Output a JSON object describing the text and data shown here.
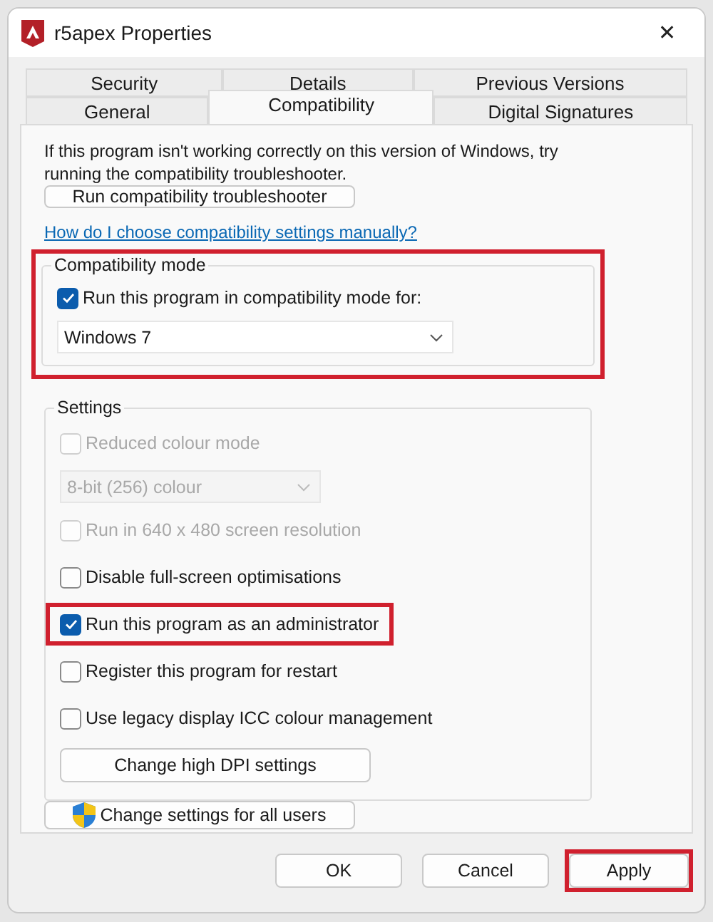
{
  "window": {
    "title": "r5apex Properties",
    "close": "✕"
  },
  "tabs": [
    [
      {
        "label": "Security",
        "selected": false
      },
      {
        "label": "Details",
        "selected": false
      },
      {
        "label": "Previous Versions",
        "selected": false
      }
    ],
    [
      {
        "label": "General",
        "selected": false
      },
      {
        "label": "Compatibility",
        "selected": true
      },
      {
        "label": "Digital Signatures",
        "selected": false
      }
    ]
  ],
  "intro": "If this program isn't working correctly on this version of Windows, try running the compatibility troubleshooter.",
  "troubleshooter_button": "Run compatibility troubleshooter",
  "help_link": "How do I choose compatibility settings manually?",
  "compatibility_mode": {
    "title": "Compatibility mode",
    "highlighted": true,
    "checkbox": {
      "label": "Run this program in compatibility mode for:",
      "checked": true
    },
    "dropdown": {
      "value": "Windows 7",
      "disabled": false
    }
  },
  "settings": {
    "title": "Settings",
    "items": [
      {
        "kind": "checkbox",
        "label": "Reduced colour mode",
        "checked": false,
        "disabled": true,
        "highlighted": false
      },
      {
        "kind": "dropdown",
        "value": "8-bit (256) colour",
        "disabled": true
      },
      {
        "kind": "checkbox",
        "label": "Run in 640 x 480 screen resolution",
        "checked": false,
        "disabled": true,
        "highlighted": false
      },
      {
        "kind": "checkbox",
        "label": "Disable full-screen optimisations",
        "checked": false,
        "disabled": false,
        "highlighted": false
      },
      {
        "kind": "checkbox",
        "label": "Run this program as an administrator",
        "checked": true,
        "disabled": false,
        "highlighted": true
      },
      {
        "kind": "checkbox",
        "label": "Register this program for restart",
        "checked": false,
        "disabled": false,
        "highlighted": false
      },
      {
        "kind": "checkbox",
        "label": "Use legacy display ICC colour management",
        "checked": false,
        "disabled": false,
        "highlighted": false
      },
      {
        "kind": "button",
        "label": "Change high DPI settings"
      }
    ]
  },
  "all_users_button": "Change settings for all users",
  "buttons": [
    {
      "label": "OK",
      "highlighted": false
    },
    {
      "label": "Cancel",
      "highlighted": false
    },
    {
      "label": "Apply",
      "highlighted": true
    }
  ]
}
